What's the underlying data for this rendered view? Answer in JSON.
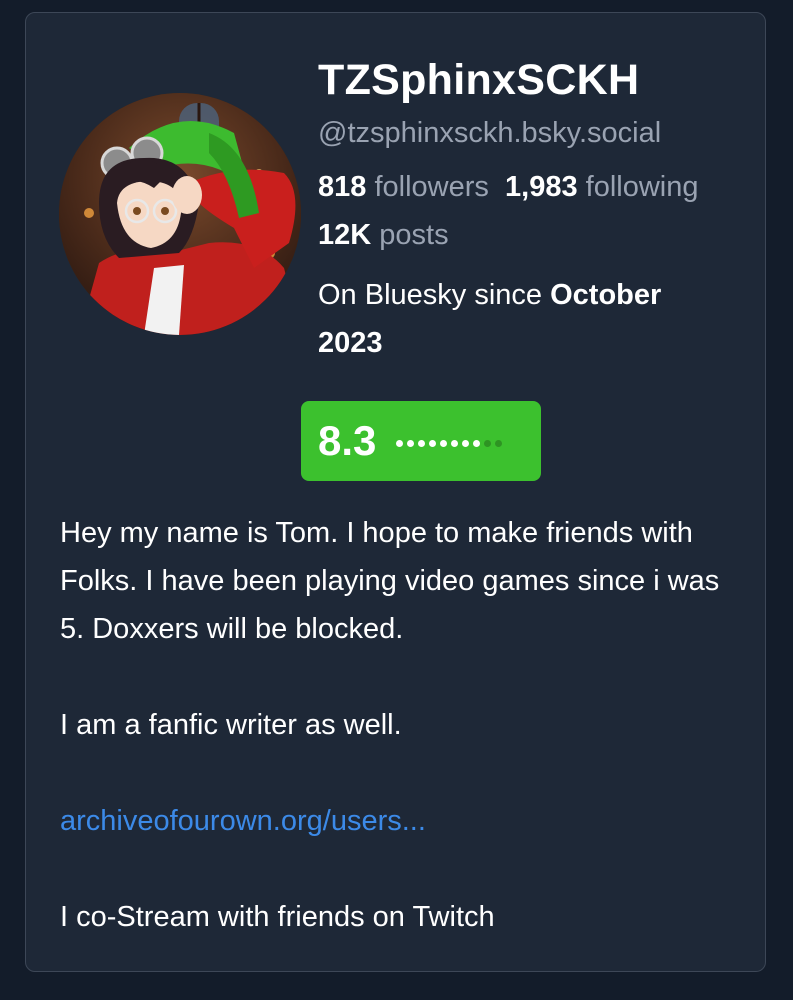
{
  "profile": {
    "display_name": "TZSphinxSCKH",
    "handle": "@tzsphinxsckh.bsky.social",
    "followers_count": "818",
    "followers_label": "followers",
    "following_count": "1,983",
    "following_label": "following",
    "posts_count": "12K",
    "posts_label": "posts",
    "since_prefix": "On Bluesky since ",
    "since_date": "October 2023",
    "avatar_icon": "anime-character-avatar"
  },
  "score": {
    "value": "8.3",
    "dots_filled": 8,
    "dots_total": 10,
    "color": "#3cc12e"
  },
  "bio": {
    "line1": "Hey my name is Tom. I hope to make friends with Folks. I have been playing video games since i was 5. Doxxers will be blocked.",
    "line2": "I am a fanfic writer as well.",
    "link_text": "archiveofourown.org/users...",
    "line3": "I co-Stream with friends on Twitch"
  },
  "colors": {
    "background": "#131c2a",
    "card": "#1e2837",
    "muted_text": "#9aa3b2",
    "link": "#3c8ae8"
  }
}
